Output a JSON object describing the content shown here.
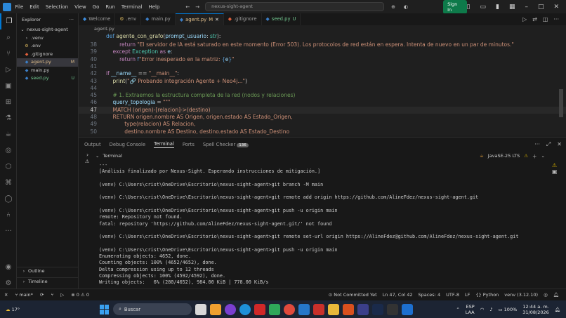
{
  "titlebar": {
    "menu": [
      "File",
      "Edit",
      "Selection",
      "View",
      "Go",
      "Run",
      "Terminal",
      "Help"
    ],
    "search_text": "nexus-sight-agent",
    "signin_label": "Sign In"
  },
  "sidebar": {
    "header": "Explorer",
    "root": "nexus-sight-agent",
    "items": [
      {
        "name": ".venv",
        "badge": "",
        "icon": "chevron-right"
      },
      {
        "name": ".env",
        "badge": "",
        "icon": "gear"
      },
      {
        "name": ".gitignore",
        "badge": "",
        "icon": "git"
      },
      {
        "name": "agent.py",
        "badge": "M",
        "icon": "python"
      },
      {
        "name": "main.py",
        "badge": "",
        "icon": "python"
      },
      {
        "name": "seed.py",
        "badge": "U",
        "icon": "python"
      }
    ],
    "outline_label": "Outline",
    "timeline_label": "Timeline"
  },
  "tabs": [
    {
      "label": "Welcome",
      "status": "",
      "active": false
    },
    {
      "label": ".env",
      "status": "",
      "active": false
    },
    {
      "label": "main.py",
      "status": "",
      "active": false
    },
    {
      "label": "agent.py",
      "status": "M",
      "active": true
    },
    {
      "label": ".gitignore",
      "status": "",
      "active": false
    },
    {
      "label": "seed.py",
      "status": "U",
      "active": false
    }
  ],
  "breadcrumb": "agent.py",
  "editor": {
    "lines": [
      {
        "n": "",
        "code": "def agente_con_grafo(prompt_usuario: str):"
      },
      {
        "n": "38",
        "code": "        return \"El servidor de IA está saturado en este momento (Error 503). Los protocolos de red están en espera. Intenta de nuevo en un par de minutos.\""
      },
      {
        "n": "39",
        "code": "    except Exception as e:"
      },
      {
        "n": "40",
        "code": "        return f\"Error inesperado en la matriz: {e}\""
      },
      {
        "n": "41",
        "code": ""
      },
      {
        "n": "42",
        "code": "if __name__ == \"__main__\":"
      },
      {
        "n": "43",
        "code": "    print(\"🔗 Probando integración Agente + Neo4j...\")"
      },
      {
        "n": "44",
        "code": ""
      },
      {
        "n": "45",
        "code": "    # 1. Extraemos la estructura completa de la red (nodos y relaciones)"
      },
      {
        "n": "46",
        "code": "    query_topologia = \"\"\""
      },
      {
        "n": "47",
        "code": "    MATCH (origen)-[relacion]->(destino)"
      },
      {
        "n": "48",
        "code": "    RETURN origen.nombre AS Origen, origen.estado AS Estado_Origen,"
      },
      {
        "n": "49",
        "code": "           type(relacion) AS Relacion,"
      },
      {
        "n": "50",
        "code": "           destino.nombre AS Destino, destino.estado AS Estado_Destino"
      }
    ],
    "current_line": "47"
  },
  "panel": {
    "tabs": [
      "Output",
      "Debug Console",
      "Terminal",
      "Ports",
      "Spell Checker"
    ],
    "active_tab": "Terminal",
    "spell_badge": "136",
    "terminal_label": "Terminal",
    "java_label": "JavaSE-25 LTS"
  },
  "terminal": {
    "lines": [
      "---",
      "[Análisis finalizado por Nexus-Sight. Esperando instrucciones de mitigación.]",
      "",
      "(venv) C:\\Users\\crist\\OneDrive\\Escritorio\\nexus-sight-agent>git branch -M main",
      "",
      "(venv) C:\\Users\\crist\\OneDrive\\Escritorio\\nexus-sight-agent>git remote add origin https://github.com/AlineFdez/nexus-sight-agent.git",
      "",
      "(venv) C:\\Users\\crist\\OneDrive\\Escritorio\\nexus-sight-agent>git push -u origin main",
      "remote: Repository not found.",
      "fatal: repository 'https://github.com/AlineFdez/nexus-sight-agent.git/' not found",
      "",
      "(venv) C:\\Users\\crist\\OneDrive\\Escritorio\\nexus-sight-agent>git remote set-url origin https://AlineFdez@github.com/AlineFdez/nexus-sight-agent.git",
      "",
      "(venv) C:\\Users\\crist\\OneDrive\\Escritorio\\nexus-sight-agent>git push -u origin main",
      "Enumerating objects: 4652, done.",
      "Counting objects: 100% (4652/4652), done.",
      "Delta compression using up to 12 threads",
      "Compressing objects: 100% (4592/4592), done.",
      "Writing objects:   6% (280/4652), 984.00 KiB | 778.00 KiB/s"
    ]
  },
  "statusbar": {
    "branch": "main*",
    "errors": "0",
    "warnings": "0",
    "commit_status": "Not Committed Yet",
    "position": "Ln 47, Col 42",
    "spaces": "Spaces: 4",
    "encoding": "UTF-8",
    "eol": "LF",
    "language": "Python",
    "interpreter": "venv (3.12.10)"
  },
  "taskbar": {
    "temperature": "17°",
    "search_label": "Buscar",
    "lang_top": "ESP",
    "lang_bottom": "LAA",
    "battery": "100%",
    "time": "12:44 a. m.",
    "date": "31/08/2026"
  }
}
